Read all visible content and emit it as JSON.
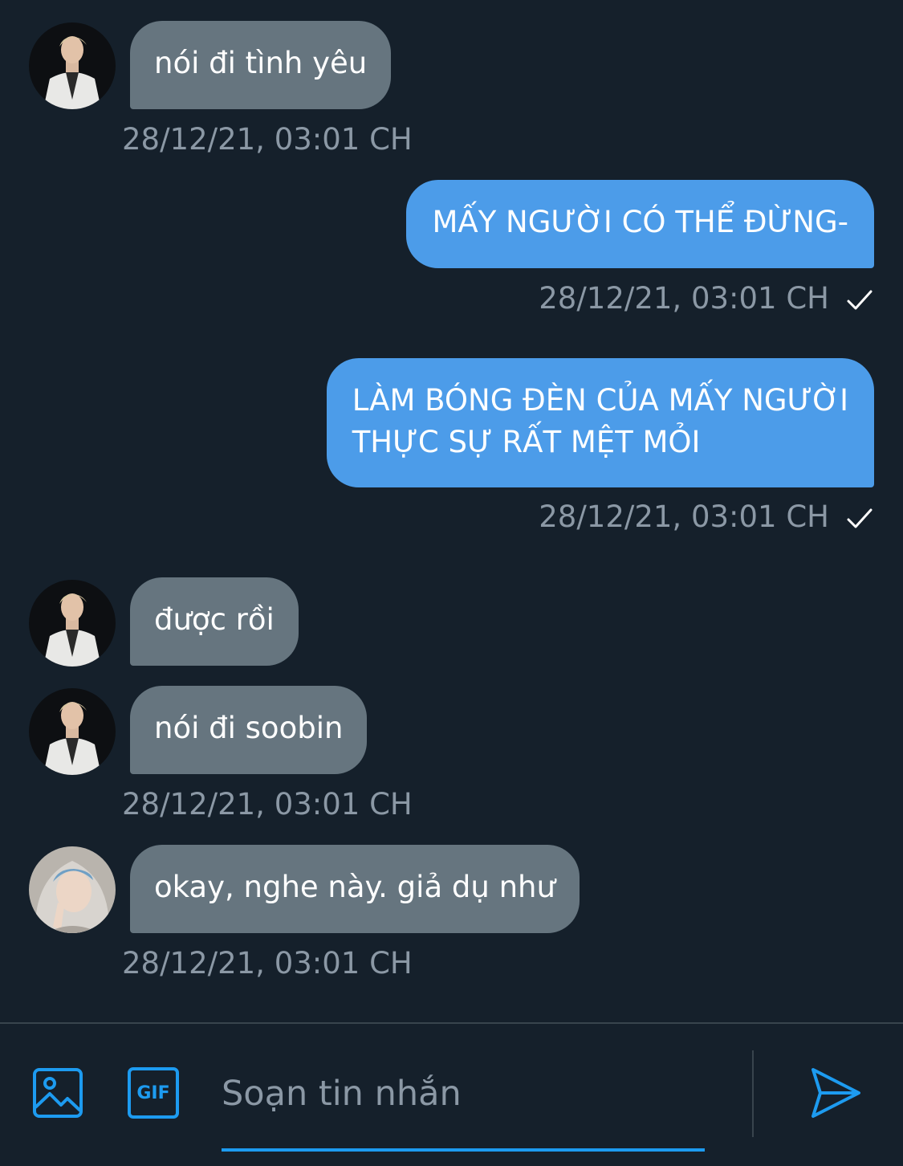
{
  "messages": [
    {
      "text": "nói đi tình yêu",
      "timestamp": "28/12/21, 03:01 CH"
    },
    {
      "text": "MẤY NGƯỜI CÓ THỂ ĐỪNG-",
      "timestamp": "28/12/21, 03:01 CH",
      "status_icon": "check-icon"
    },
    {
      "text_line1": "LÀM BÓNG ĐÈN CỦA MẤY NGƯỜI",
      "text_line2": "THỰC SỰ RẤT MỆT MỎI",
      "timestamp": "28/12/21, 03:01 CH",
      "status_icon": "check-icon"
    },
    {
      "text": "được rồi"
    },
    {
      "text": "nói đi soobin",
      "timestamp": "28/12/21, 03:01 CH"
    },
    {
      "text": "okay, nghe này. giả dụ như",
      "timestamp": "28/12/21, 03:01 CH"
    }
  ],
  "composer": {
    "placeholder": "Soạn tin nhắn",
    "gif_label": "GIF",
    "icons": [
      "image-icon",
      "gif-icon",
      "send-icon"
    ]
  },
  "colors": {
    "background": "#15202b",
    "incoming_bubble": "#66757f",
    "outgoing_bubble": "#4c9ce9",
    "timestamp": "#8b98a5",
    "accent": "#1d9bf0"
  }
}
